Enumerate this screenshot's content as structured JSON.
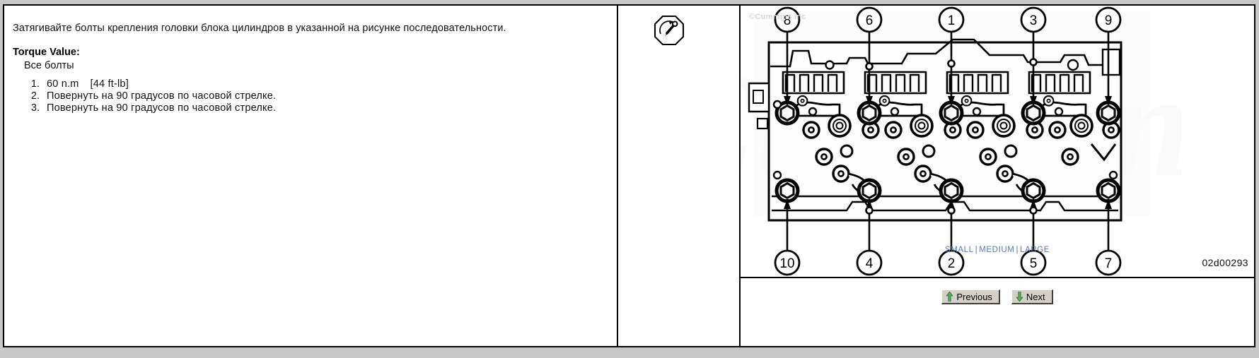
{
  "left_panel": {
    "instruction": "Затягивайте болты крепления головки блока цилиндров в указанной на рисунке последовательности.",
    "torque_heading": "Torque Value:",
    "torque_subject": "Все болты",
    "steps": [
      {
        "value": "60 n.m",
        "alt": "[44 ft-lb]"
      },
      {
        "value": "Повернуть на 90 градусов по часовой стрелке.",
        "alt": ""
      },
      {
        "value": "Повернуть на 90 градусов по часовой стрелке.",
        "alt": ""
      }
    ]
  },
  "icon_panel": {
    "icon_name": "torque-wrench-icon"
  },
  "image_panel": {
    "copyright": "©Cummins Inc",
    "watermark": "Cummins",
    "figure_id": "02d00293",
    "callouts_top": [
      "8",
      "6",
      "1",
      "3",
      "9"
    ],
    "callouts_bottom": [
      "10",
      "4",
      "2",
      "5",
      "7"
    ],
    "size_links": [
      "SMALL",
      "MEDIUM",
      "LARGE"
    ],
    "separator": "|",
    "buttons": [
      {
        "label": "Previous",
        "icon": "arrow-up-icon",
        "direction": "up"
      },
      {
        "label": "Next",
        "icon": "arrow-down-icon",
        "direction": "down"
      }
    ],
    "link_color": "#5a79b0",
    "arrow_color": "#5aa85a"
  }
}
